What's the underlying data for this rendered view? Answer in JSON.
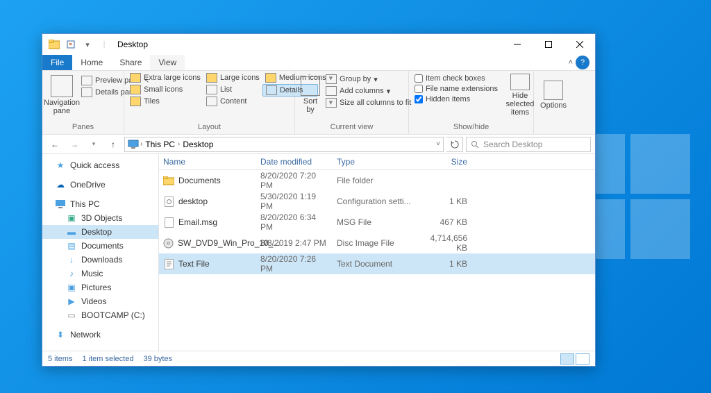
{
  "window": {
    "title": "Desktop"
  },
  "tabs": {
    "file": "File",
    "home": "Home",
    "share": "Share",
    "view": "View"
  },
  "ribbon": {
    "panes": {
      "label": "Panes",
      "navigation": "Navigation pane",
      "preview": "Preview pane",
      "details": "Details pane"
    },
    "layout": {
      "label": "Layout",
      "extra_large": "Extra large icons",
      "large": "Large icons",
      "medium": "Medium icons",
      "small": "Small icons",
      "list": "List",
      "details": "Details",
      "tiles": "Tiles",
      "content": "Content"
    },
    "current_view": {
      "label": "Current view",
      "sort_by": "Sort by",
      "group_by": "Group by",
      "add_columns": "Add columns",
      "size_columns": "Size all columns to fit"
    },
    "show_hide": {
      "label": "Show/hide",
      "item_check": "Item check boxes",
      "extensions": "File name extensions",
      "hidden": "Hidden items",
      "hide_selected": "Hide selected items"
    },
    "options": "Options"
  },
  "breadcrumb": {
    "root": "This PC",
    "current": "Desktop"
  },
  "search": {
    "placeholder": "Search Desktop"
  },
  "nav": {
    "quick_access": "Quick access",
    "onedrive": "OneDrive",
    "this_pc": "This PC",
    "objects3d": "3D Objects",
    "desktop": "Desktop",
    "documents": "Documents",
    "downloads": "Downloads",
    "music": "Music",
    "pictures": "Pictures",
    "videos": "Videos",
    "bootcamp": "BOOTCAMP (C:)",
    "network": "Network"
  },
  "columns": {
    "name": "Name",
    "date": "Date modified",
    "type": "Type",
    "size": "Size"
  },
  "files": [
    {
      "name": "Documents",
      "date": "8/20/2020 7:20 PM",
      "type": "File folder",
      "size": ""
    },
    {
      "name": "desktop",
      "date": "5/30/2020 1:19 PM",
      "type": "Configuration setti...",
      "size": "1 KB"
    },
    {
      "name": "Email.msg",
      "date": "8/20/2020 6:34 PM",
      "type": "MSG File",
      "size": "467 KB"
    },
    {
      "name": "SW_DVD9_Win_Pro_10_...",
      "date": "8/8/2019 2:47 PM",
      "type": "Disc Image File",
      "size": "4,714,656 KB"
    },
    {
      "name": "Text File",
      "date": "8/20/2020 7:26 PM",
      "type": "Text Document",
      "size": "1 KB"
    }
  ],
  "status": {
    "items": "5 items",
    "selected": "1 item selected",
    "bytes": "39 bytes"
  },
  "colors": {
    "accent": "#1979ca",
    "selection": "#cde6f7"
  }
}
